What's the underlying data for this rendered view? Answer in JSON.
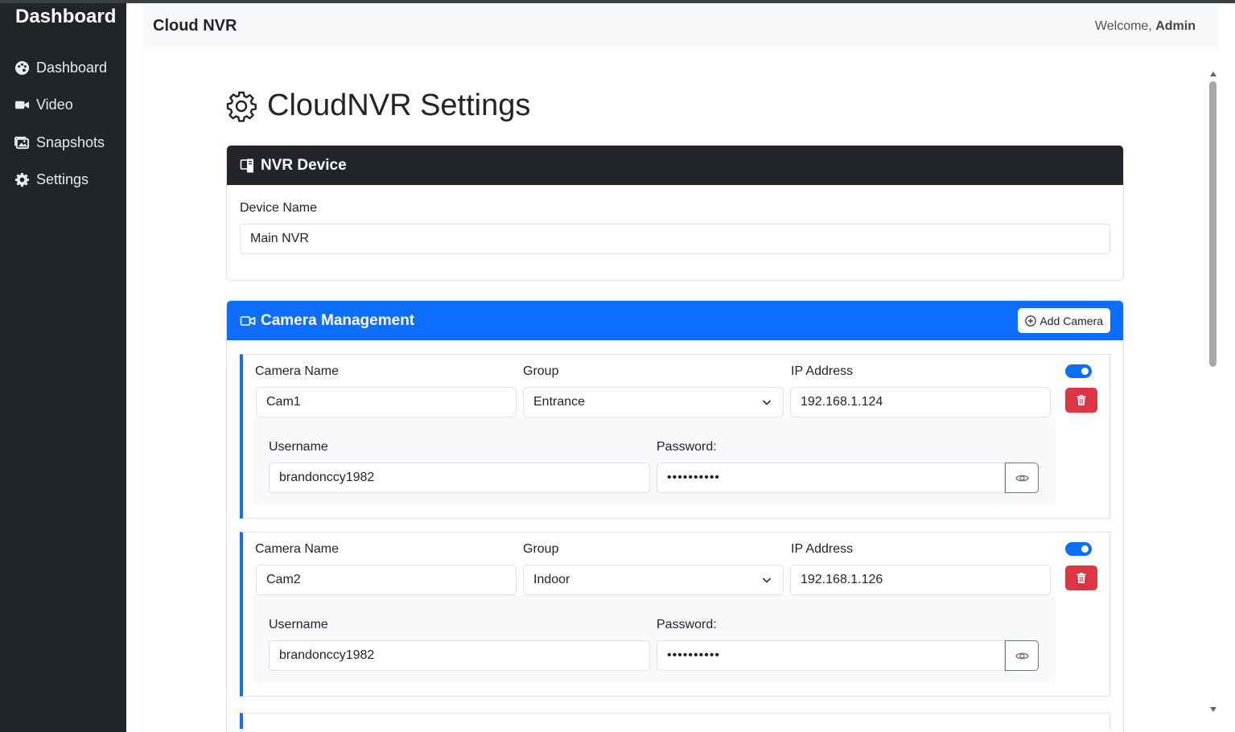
{
  "sidebar": {
    "brand": "Dashboard",
    "items": [
      {
        "label": "Dashboard",
        "icon": "palette-icon"
      },
      {
        "label": "Video",
        "icon": "video-icon"
      },
      {
        "label": "Snapshots",
        "icon": "images-icon"
      },
      {
        "label": "Settings",
        "icon": "gear-icon"
      }
    ]
  },
  "topbar": {
    "title": "Cloud NVR",
    "welcome_prefix": "Welcome,",
    "user": "Admin"
  },
  "page": {
    "title": "CloudNVR Settings"
  },
  "nvr_device": {
    "header": "NVR Device",
    "device_name_label": "Device Name",
    "device_name_value": "Main NVR"
  },
  "camera_management": {
    "header": "Camera Management",
    "add_button": "Add Camera",
    "cameras": [
      {
        "name_label": "Camera Name",
        "name": "Cam1",
        "group_label": "Group",
        "group": "Entrance",
        "ip_label": "IP Address",
        "ip": "192.168.1.124",
        "username_label": "Username",
        "username": "brandonccy1982",
        "password_label": "Password:",
        "password_masked": "••••••••••",
        "enabled": true
      },
      {
        "name_label": "Camera Name",
        "name": "Cam2",
        "group_label": "Group",
        "group": "Indoor",
        "ip_label": "IP Address",
        "ip": "192.168.1.126",
        "username_label": "Username",
        "username": "brandonccy1982",
        "password_label": "Password:",
        "password_masked": "••••••••••",
        "enabled": true
      }
    ]
  },
  "colors": {
    "sidebar_bg": "#212529",
    "primary": "#0d6efd",
    "danger": "#dc3545",
    "light_bg": "#f8f9fa"
  }
}
